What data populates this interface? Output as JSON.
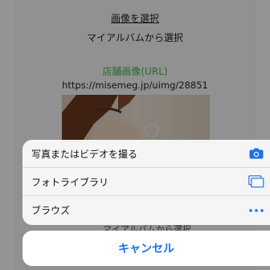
{
  "background": {
    "select_link": "画像を選択",
    "album_select": "マイアルバムから選択",
    "store_image_label": "店舗画像(URL)",
    "url": "https://misemeg.jp/uimg/28851",
    "peek_text": "マイアルバムから選択"
  },
  "action_sheet": {
    "items": [
      {
        "label": "写真またはビデオを撮る",
        "icon": "camera-icon"
      },
      {
        "label": "フォトライブラリ",
        "icon": "photo-library-icon"
      },
      {
        "label": "ブラウズ",
        "icon": "more-icon"
      }
    ],
    "cancel_label": "キャンセル"
  },
  "colors": {
    "accent": "#1a73e8",
    "green_label": "#4caf50",
    "overlay": "rgba(0,0,0,0.42)"
  }
}
